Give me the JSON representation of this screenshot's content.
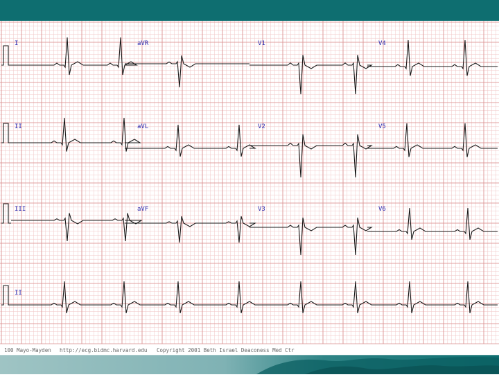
{
  "leads": {
    "row1": [
      "I",
      "aVR",
      "V1",
      "V4"
    ],
    "row2": [
      "II",
      "aVL",
      "V2",
      "V5"
    ],
    "row3": [
      "III",
      "aVF",
      "V3",
      "V6"
    ],
    "row4": [
      "II"
    ]
  },
  "footer": {
    "left": "100 Mayo-Mayden",
    "middle": "http://ecg.bidmc.harvard.edu",
    "right": "Copyright 2001 Beth Israel Deaconess Med Ctr"
  },
  "colors": {
    "header_bar": "#0e6e70",
    "grid_minor": "#f0c6c6",
    "grid_major": "#d98d8d",
    "trace": "#1a1a1a",
    "label": "#2a2ab0"
  }
}
